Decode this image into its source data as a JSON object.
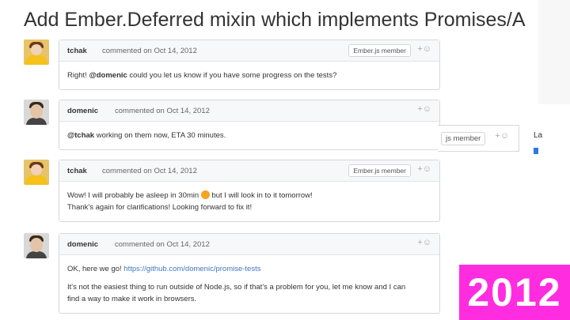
{
  "issue": {
    "title": "Add Ember.Deferred mixin which implements Promises/A"
  },
  "comments": [
    {
      "author": "tchak",
      "meta": "commented on Oct 14, 2012",
      "badge": "Ember.js member",
      "body_line1_prefix": "Right! ",
      "body_line1_mention": "@domenic",
      "body_line1_rest": " could you let us know if you have some progress on the tests?"
    },
    {
      "author": "domenic",
      "meta": "commented on Oct 14, 2012",
      "body_mention": "@tchak",
      "body_rest": " working on them now, ETA 30 minutes."
    },
    {
      "author": "tchak",
      "meta": "commented on Oct 14, 2012",
      "badge": "Ember.js member",
      "body_line1_a": "Wow! I will probably be asleep in 30min",
      "body_line1_b": " but I will look in to it tomorrow!",
      "body_line2": "Thank's again for clarifications! Looking forward to fix it!"
    },
    {
      "author": "domenic",
      "meta": "commented on Oct 14, 2012",
      "body_line1_prefix": "OK, here we go! ",
      "body_link": "https://github.com/domenic/promise-tests",
      "body_line2": "It's not the easiest thing to run outside of Node.js, so if that's a problem for you, let me know and I can",
      "body_line3": "find a way to make it work in browsers."
    }
  ],
  "sidebar_fragment": {
    "badge": "js member",
    "label": "La"
  },
  "reaction_glyph": "+☺",
  "year_tag": "2012",
  "colors": {
    "tag_bg": "#ff2ce0",
    "link": "#4078c0"
  }
}
